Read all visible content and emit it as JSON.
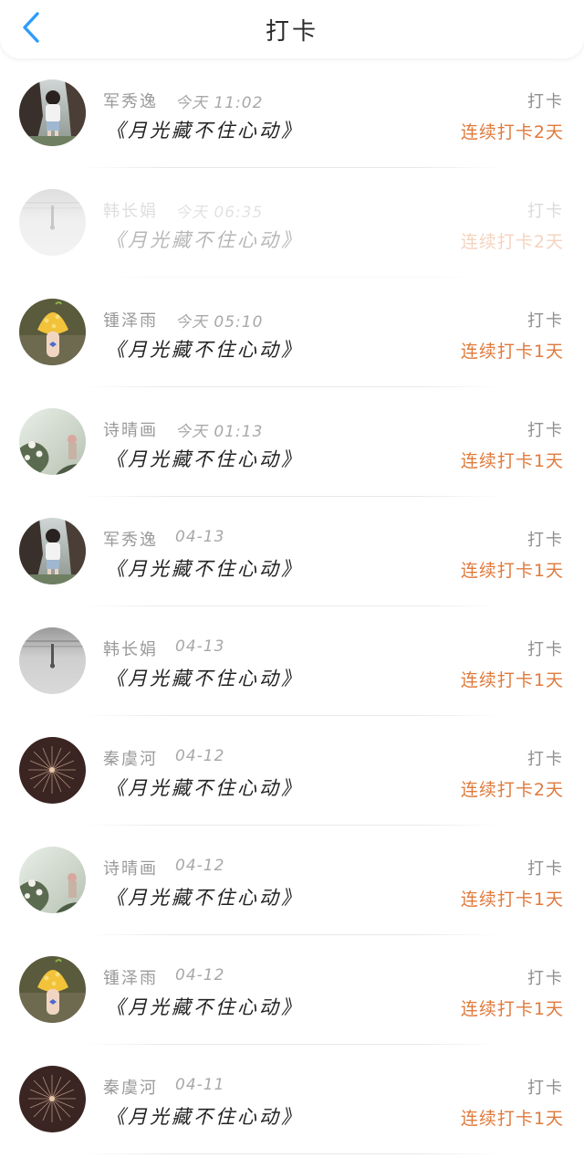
{
  "header": {
    "title": "打卡",
    "back_icon": "chevron-left-icon",
    "accent_color": "#2f9bff"
  },
  "colors": {
    "streak": "#e07a3c"
  },
  "items": [
    {
      "name": "军秀逸",
      "time": "今天 11:02",
      "content": "《月光藏不住心动》",
      "action": "打卡",
      "streak": "连续打卡2天",
      "avatar": "girl-by-tree-avatar",
      "faded": false
    },
    {
      "name": "韩长娟",
      "time": "今天 06:35",
      "content": "《月光藏不住心动》",
      "action": "打卡",
      "streak": "连续打卡2天",
      "avatar": "grey-reflection-avatar",
      "faded": true
    },
    {
      "name": "锺泽雨",
      "time": "今天 05:10",
      "content": "《月光藏不住心动》",
      "action": "打卡",
      "streak": "连续打卡1天",
      "avatar": "yellow-mushroom-avatar",
      "faded": false
    },
    {
      "name": "诗晴画",
      "time": "今天 01:13",
      "content": "《月光藏不住心动》",
      "action": "打卡",
      "streak": "连续打卡1天",
      "avatar": "flower-garden-avatar",
      "faded": false
    },
    {
      "name": "军秀逸",
      "time": "04-13",
      "content": "《月光藏不住心动》",
      "action": "打卡",
      "streak": "连续打卡1天",
      "avatar": "girl-by-tree-avatar",
      "faded": false
    },
    {
      "name": "韩长娟",
      "time": "04-13",
      "content": "《月光藏不住心动》",
      "action": "打卡",
      "streak": "连续打卡1天",
      "avatar": "grey-reflection-avatar",
      "faded": false
    },
    {
      "name": "秦虞河",
      "time": "04-12",
      "content": "《月光藏不住心动》",
      "action": "打卡",
      "streak": "连续打卡2天",
      "avatar": "fireworks-avatar",
      "faded": false
    },
    {
      "name": "诗晴画",
      "time": "04-12",
      "content": "《月光藏不住心动》",
      "action": "打卡",
      "streak": "连续打卡1天",
      "avatar": "flower-garden-avatar",
      "faded": false
    },
    {
      "name": "锺泽雨",
      "time": "04-12",
      "content": "《月光藏不住心动》",
      "action": "打卡",
      "streak": "连续打卡1天",
      "avatar": "yellow-mushroom-avatar",
      "faded": false
    },
    {
      "name": "秦虞河",
      "time": "04-11",
      "content": "《月光藏不住心动》",
      "action": "打卡",
      "streak": "连续打卡1天",
      "avatar": "fireworks-avatar",
      "faded": false
    }
  ]
}
